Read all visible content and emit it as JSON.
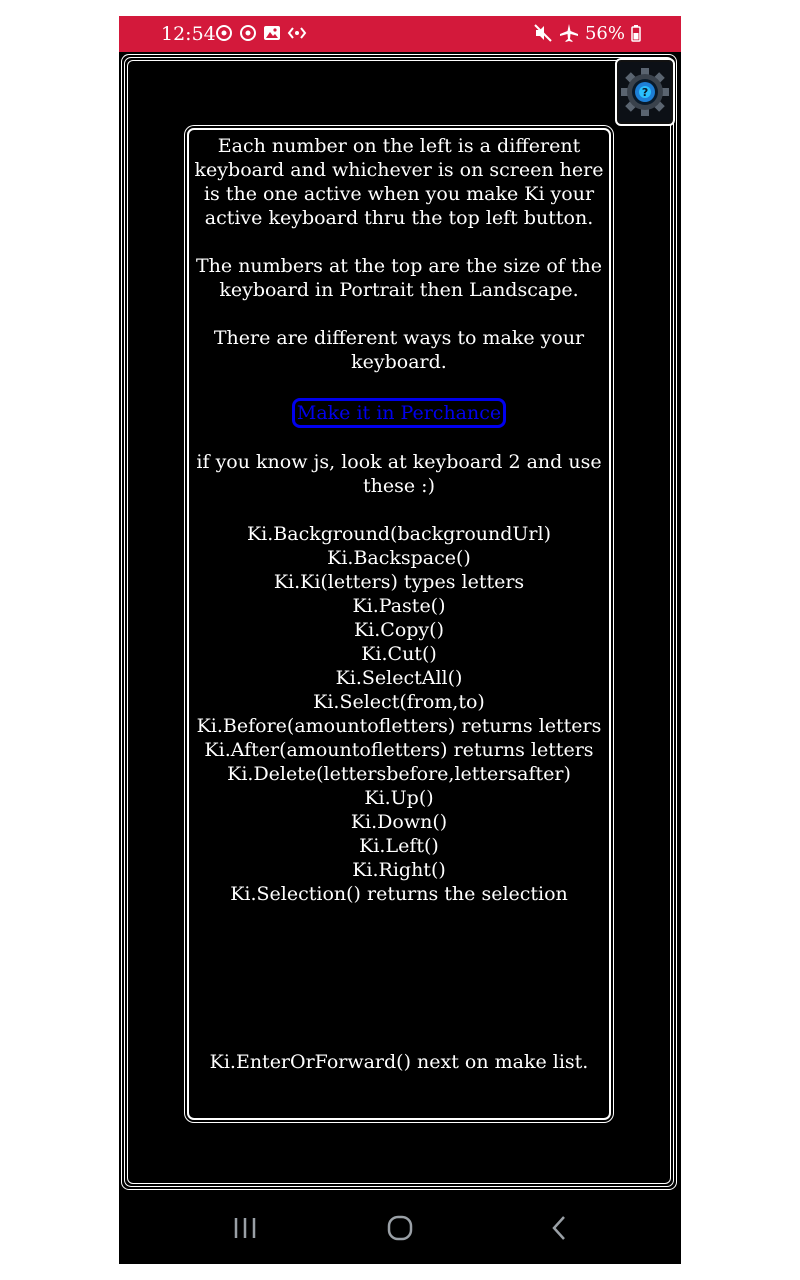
{
  "status_bar": {
    "time": "12:54",
    "battery": "56%",
    "left_icons": [
      "sync-icon",
      "sync-icon",
      "image-icon",
      "code-icon"
    ],
    "right_icons": [
      "mute-icon",
      "airplane-icon"
    ],
    "color": "#d3193b"
  },
  "app": {
    "settings_icon": "gear-icon",
    "intro_paragraph": "Each number on the left is a different keyboard and whichever is on screen here is the one active when you make Ki your active keyboard thru the top left button.",
    "size_paragraph": "The numbers at the top are the size of the keyboard in Portrait then Landscape.",
    "ways_paragraph": "There are different ways to make your keyboard.",
    "make_button_label": "Make it in Perchance",
    "js_paragraph": "if you know js, look at keyboard 2 and use these :)",
    "functions": [
      "Ki.Background(backgroundUrl)",
      "Ki.Backspace()",
      "Ki.Ki(letters) types letters",
      "Ki.Paste()",
      "Ki.Copy()",
      "Ki.Cut()",
      "Ki.SelectAll()",
      "Ki.Select(from,to)",
      "Ki.Before(amountofletters) returns letters",
      "Ki.After(amountofletters) returns letters",
      "Ki.Delete(lettersbefore,lettersafter)",
      "Ki.Up()",
      "Ki.Down()",
      "Ki.Left()",
      "Ki.Right()",
      "Ki.Selection() returns the selection"
    ],
    "next_line": "Ki.EnterOrForward() next on make list.",
    "link_color": "#0000ee"
  },
  "nav_bar": {
    "buttons": [
      "recent-apps-icon",
      "home-icon",
      "back-icon"
    ]
  }
}
